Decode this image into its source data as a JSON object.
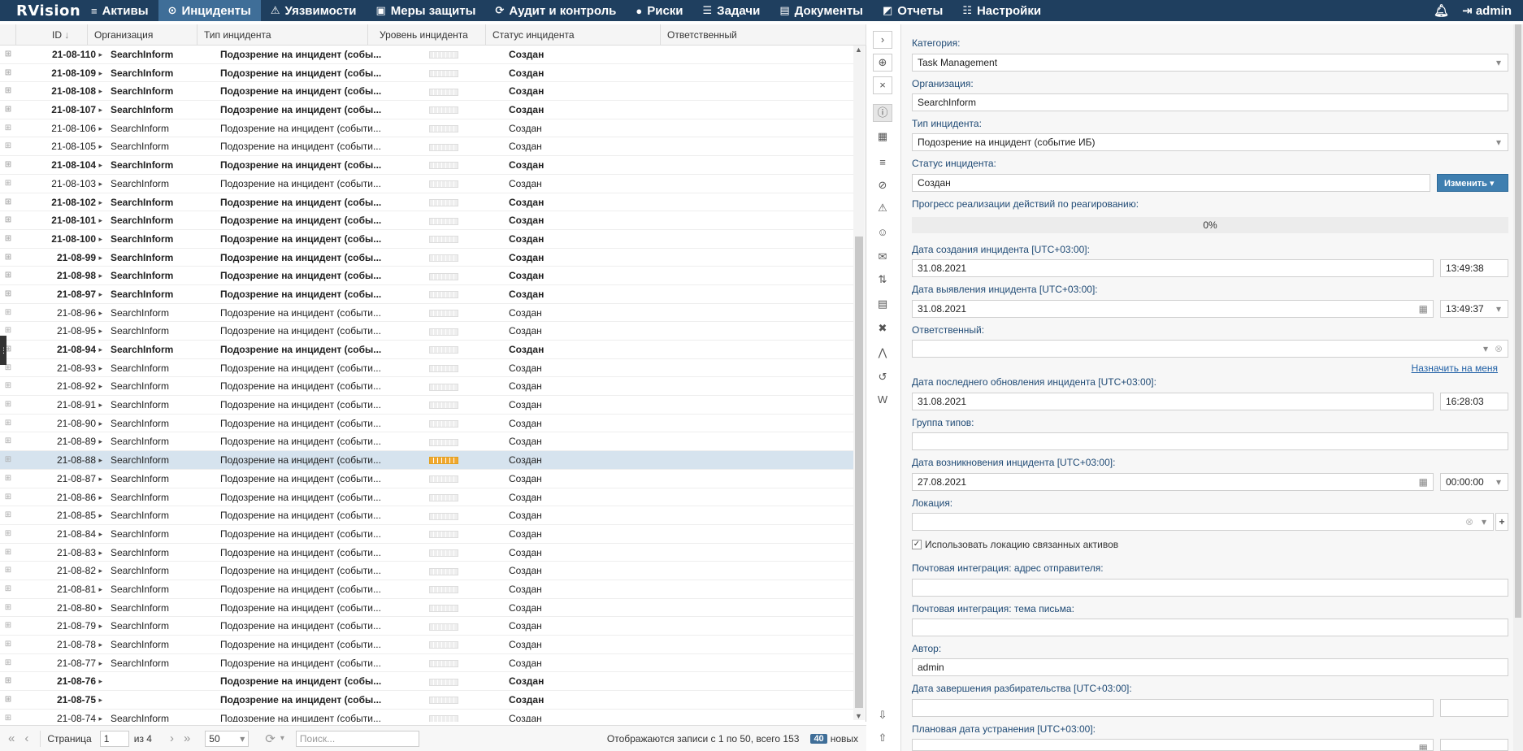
{
  "nav": {
    "logo": "RVision",
    "items": [
      {
        "label": "Активы",
        "icon": "database-icon",
        "glyph": "≡"
      },
      {
        "label": "Инциденты",
        "icon": "target-icon",
        "glyph": "⊙"
      },
      {
        "label": "Уязвимости",
        "icon": "warning-icon",
        "glyph": "⚠"
      },
      {
        "label": "Меры защиты",
        "icon": "shield-icon",
        "glyph": "▣"
      },
      {
        "label": "Аудит и контроль",
        "icon": "refresh-icon",
        "glyph": "⟳"
      },
      {
        "label": "Риски",
        "icon": "alert-icon",
        "glyph": "●"
      },
      {
        "label": "Задачи",
        "icon": "tasks-icon",
        "glyph": "☰"
      },
      {
        "label": "Документы",
        "icon": "document-icon",
        "glyph": "▤"
      },
      {
        "label": "Отчеты",
        "icon": "report-icon",
        "glyph": "◩"
      },
      {
        "label": "Настройки",
        "icon": "settings-icon",
        "glyph": "☷"
      }
    ],
    "active": "Инциденты",
    "user": "admin"
  },
  "grid": {
    "columns": [
      "ID",
      "Организация",
      "Тип инцидента",
      "Уровень инцидента",
      "Статус инцидента",
      "Ответственный"
    ],
    "rows": [
      {
        "id": "21-08-110",
        "org": "SearchInform",
        "type": "Подозрение на инцидент (собы...",
        "status": "Создан",
        "bold": true
      },
      {
        "id": "21-08-109",
        "org": "SearchInform",
        "type": "Подозрение на инцидент (собы...",
        "status": "Создан",
        "bold": true
      },
      {
        "id": "21-08-108",
        "org": "SearchInform",
        "type": "Подозрение на инцидент (собы...",
        "status": "Создан",
        "bold": true
      },
      {
        "id": "21-08-107",
        "org": "SearchInform",
        "type": "Подозрение на инцидент (собы...",
        "status": "Создан",
        "bold": true
      },
      {
        "id": "21-08-106",
        "org": "SearchInform",
        "type": "Подозрение на инцидент (событи...",
        "status": "Создан",
        "bold": false
      },
      {
        "id": "21-08-105",
        "org": "SearchInform",
        "type": "Подозрение на инцидент (событи...",
        "status": "Создан",
        "bold": false
      },
      {
        "id": "21-08-104",
        "org": "SearchInform",
        "type": "Подозрение на инцидент (собы...",
        "status": "Создан",
        "bold": true
      },
      {
        "id": "21-08-103",
        "org": "SearchInform",
        "type": "Подозрение на инцидент (событи...",
        "status": "Создан",
        "bold": false
      },
      {
        "id": "21-08-102",
        "org": "SearchInform",
        "type": "Подозрение на инцидент (собы...",
        "status": "Создан",
        "bold": true
      },
      {
        "id": "21-08-101",
        "org": "SearchInform",
        "type": "Подозрение на инцидент (собы...",
        "status": "Создан",
        "bold": true
      },
      {
        "id": "21-08-100",
        "org": "SearchInform",
        "type": "Подозрение на инцидент (собы...",
        "status": "Создан",
        "bold": true
      },
      {
        "id": "21-08-99",
        "org": "SearchInform",
        "type": "Подозрение на инцидент (собы...",
        "status": "Создан",
        "bold": true
      },
      {
        "id": "21-08-98",
        "org": "SearchInform",
        "type": "Подозрение на инцидент (собы...",
        "status": "Создан",
        "bold": true
      },
      {
        "id": "21-08-97",
        "org": "SearchInform",
        "type": "Подозрение на инцидент (собы...",
        "status": "Создан",
        "bold": true
      },
      {
        "id": "21-08-96",
        "org": "SearchInform",
        "type": "Подозрение на инцидент (событи...",
        "status": "Создан",
        "bold": false
      },
      {
        "id": "21-08-95",
        "org": "SearchInform",
        "type": "Подозрение на инцидент (событи...",
        "status": "Создан",
        "bold": false
      },
      {
        "id": "21-08-94",
        "org": "SearchInform",
        "type": "Подозрение на инцидент (собы...",
        "status": "Создан",
        "bold": true
      },
      {
        "id": "21-08-93",
        "org": "SearchInform",
        "type": "Подозрение на инцидент (событи...",
        "status": "Создан",
        "bold": false
      },
      {
        "id": "21-08-92",
        "org": "SearchInform",
        "type": "Подозрение на инцидент (событи...",
        "status": "Создан",
        "bold": false
      },
      {
        "id": "21-08-91",
        "org": "SearchInform",
        "type": "Подозрение на инцидент (событи...",
        "status": "Создан",
        "bold": false
      },
      {
        "id": "21-08-90",
        "org": "SearchInform",
        "type": "Подозрение на инцидент (событи...",
        "status": "Создан",
        "bold": false
      },
      {
        "id": "21-08-89",
        "org": "SearchInform",
        "type": "Подозрение на инцидент (событи...",
        "status": "Создан",
        "bold": false
      },
      {
        "id": "21-08-88",
        "org": "SearchInform",
        "type": "Подозрение на инцидент (событи...",
        "status": "Создан",
        "bold": false,
        "selected": true
      },
      {
        "id": "21-08-87",
        "org": "SearchInform",
        "type": "Подозрение на инцидент (событи...",
        "status": "Создан",
        "bold": false
      },
      {
        "id": "21-08-86",
        "org": "SearchInform",
        "type": "Подозрение на инцидент (событи...",
        "status": "Создан",
        "bold": false
      },
      {
        "id": "21-08-85",
        "org": "SearchInform",
        "type": "Подозрение на инцидент (событи...",
        "status": "Создан",
        "bold": false
      },
      {
        "id": "21-08-84",
        "org": "SearchInform",
        "type": "Подозрение на инцидент (событи...",
        "status": "Создан",
        "bold": false
      },
      {
        "id": "21-08-83",
        "org": "SearchInform",
        "type": "Подозрение на инцидент (событи...",
        "status": "Создан",
        "bold": false
      },
      {
        "id": "21-08-82",
        "org": "SearchInform",
        "type": "Подозрение на инцидент (событи...",
        "status": "Создан",
        "bold": false
      },
      {
        "id": "21-08-81",
        "org": "SearchInform",
        "type": "Подозрение на инцидент (событи...",
        "status": "Создан",
        "bold": false
      },
      {
        "id": "21-08-80",
        "org": "SearchInform",
        "type": "Подозрение на инцидент (событи...",
        "status": "Создан",
        "bold": false
      },
      {
        "id": "21-08-79",
        "org": "SearchInform",
        "type": "Подозрение на инцидент (событи...",
        "status": "Создан",
        "bold": false
      },
      {
        "id": "21-08-78",
        "org": "SearchInform",
        "type": "Подозрение на инцидент (событи...",
        "status": "Создан",
        "bold": false
      },
      {
        "id": "21-08-77",
        "org": "SearchInform",
        "type": "Подозрение на инцидент (событи...",
        "status": "Создан",
        "bold": false
      },
      {
        "id": "21-08-76",
        "org": "",
        "type": "Подозрение на инцидент (собы...",
        "status": "Создан",
        "bold": true
      },
      {
        "id": "21-08-75",
        "org": "",
        "type": "Подозрение на инцидент (собы...",
        "status": "Создан",
        "bold": true
      },
      {
        "id": "21-08-74",
        "org": "SearchInform",
        "type": "Подозрение на инцидент (событи...",
        "status": "Создан",
        "bold": false
      }
    ]
  },
  "pager": {
    "page_label": "Страница",
    "page": "1",
    "of_label": "из 4",
    "per_page": "50",
    "search_placeholder": "Поиск...",
    "summary": "Отображаются записи с 1 по 50, всего 153",
    "new_count": "40",
    "new_label": "новых"
  },
  "form": {
    "category_label": "Категория:",
    "category": "Task Management",
    "org_label": "Организация:",
    "org": "SearchInform",
    "type_label": "Тип инцидента:",
    "type": "Подозрение на инцидент (событие ИБ)",
    "status_label": "Статус инцидента:",
    "status": "Создан",
    "change_button": "Изменить",
    "progress_label": "Прогресс реализации действий по реагированию:",
    "progress": "0%",
    "created_label": "Дата создания инцидента [UTC+03:00]:",
    "created_date": "31.08.2021",
    "created_time": "13:49:38",
    "detected_label": "Дата выявления инцидента [UTC+03:00]:",
    "detected_date": "31.08.2021",
    "detected_time": "13:49:37",
    "responsible_label": "Ответственный:",
    "responsible": "",
    "assign_me": "Назначить на меня",
    "updated_label": "Дата последнего обновления инцидента [UTC+03:00]:",
    "updated_date": "31.08.2021",
    "updated_time": "16:28:03",
    "type_group_label": "Группа типов:",
    "occurred_label": "Дата возникновения инцидента [UTC+03:00]:",
    "occurred_date": "27.08.2021",
    "occurred_time": "00:00:00",
    "location_label": "Локация:",
    "use_location_label": "Использовать локацию связанных активов",
    "mail_from_label": "Почтовая интеграция: адрес отправителя:",
    "mail_subject_label": "Почтовая интеграция: тема письма:",
    "author_label": "Автор:",
    "author": "admin",
    "investigation_end_label": "Дата завершения разбирательства [UTC+03:00]:",
    "planned_fix_label": "Плановая дата устранения [UTC+03:00]:"
  }
}
